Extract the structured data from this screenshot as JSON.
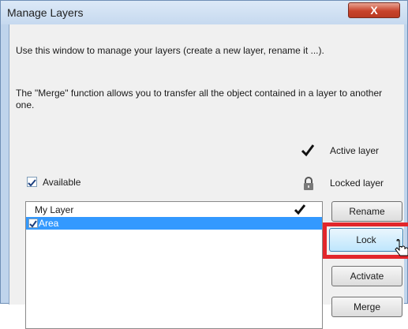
{
  "window": {
    "title": "Manage Layers",
    "close_label": "X"
  },
  "description": {
    "line1": "Use this window to manage your layers (create a new layer, rename it ...).",
    "line2": "The \"Merge\" function allows you to transfer all the object contained in a layer to another one."
  },
  "legend": {
    "active_label": "Active layer",
    "locked_label": "Locked layer",
    "active_icon": "checkmark-icon",
    "locked_icon": "padlock-icon"
  },
  "available": {
    "label": "Available",
    "checked": true
  },
  "layers": [
    {
      "name": "My Layer",
      "active": true,
      "checked": false,
      "selected": false
    },
    {
      "name": "Area",
      "active": false,
      "checked": true,
      "selected": true
    }
  ],
  "buttons": {
    "rename": "Rename",
    "lock": "Lock",
    "activate": "Activate",
    "merge": "Merge"
  },
  "colors": {
    "selection": "#3399ff",
    "highlight": "#e2262b",
    "title_close": "#c8432b"
  }
}
